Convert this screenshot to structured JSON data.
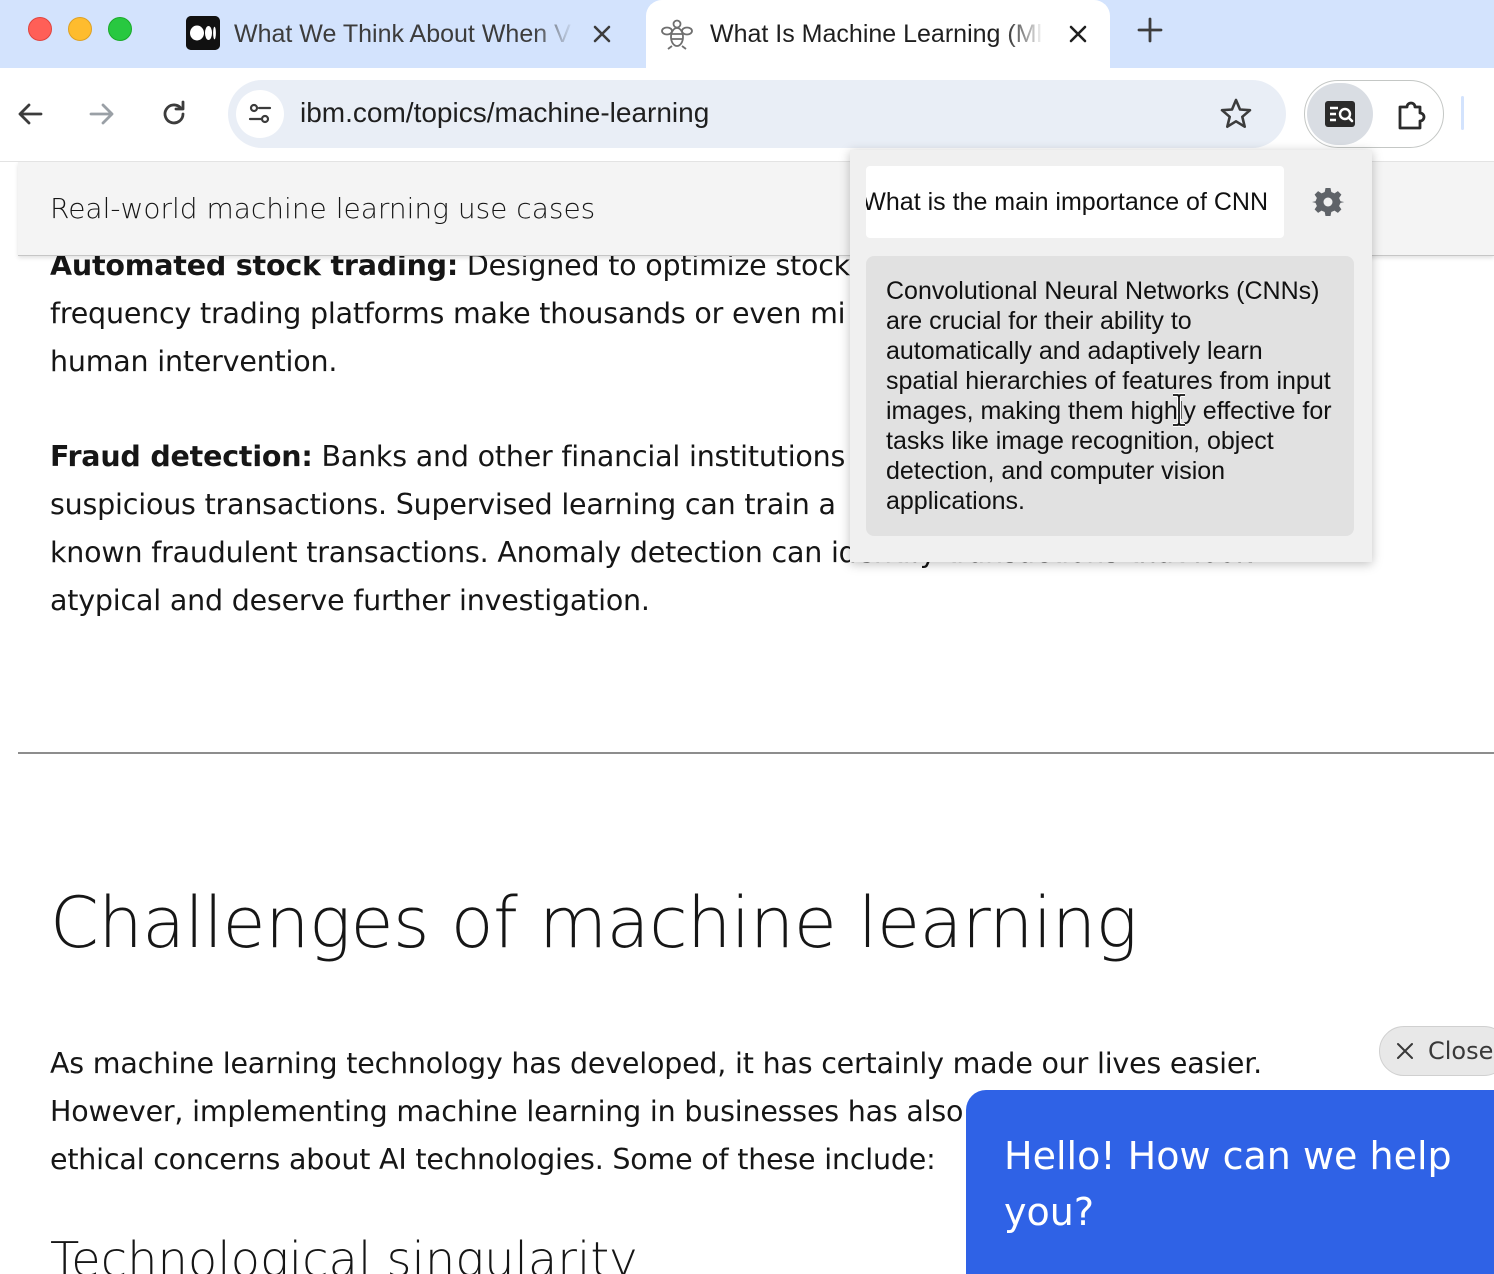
{
  "browser": {
    "tabs": [
      {
        "title": "What We Think About When V",
        "favicon": "medium-logo-icon",
        "active": false
      },
      {
        "title": "What Is Machine Learning (Ml",
        "favicon": "ibm-bee-icon",
        "active": true
      }
    ],
    "url": "ibm.com/topics/machine-learning"
  },
  "page": {
    "toc_label": "Real-world machine learning use cases",
    "p1_bold": "Automated stock trading:",
    "p1_line1": " Designed to optimize stock p",
    "p1_line2": "frequency trading platforms make thousands or even mi",
    "p1_line3": "human intervention.",
    "p2_bold": "Fraud detection:",
    "p2_line1": " Banks and other financial institutions c",
    "p2_line2": "suspicious transactions. Supervised learning can train a",
    "p2_line3": "known fraudulent transactions. Anomaly detection can identify transactions that look",
    "p2_line4": "atypical and deserve further investigation.",
    "heading": "Challenges of machine learning",
    "p3_line1": "As machine learning technology has developed, it has certainly made our lives easier.",
    "p3_line2": "However, implementing machine learning in businesses has also",
    "p3_line3": "ethical concerns about AI technologies. Some of these include:",
    "subheading": "Technological singularity"
  },
  "extension_popup": {
    "question_value": "What is the main importance of CNN",
    "answer": "Convolutional Neural Networks (CNNs) are crucial for their ability to automatically and adaptively learn spatial hierarchies of features from input images, making them highly effective for tasks like image recognition, object detection, and computer vision applications."
  },
  "chat_widget": {
    "close_label": "Close",
    "greeting": "Hello! How can we help you?"
  },
  "colors": {
    "tabstrip": "#d3e3fd",
    "chat_accent": "#2f62e6"
  }
}
